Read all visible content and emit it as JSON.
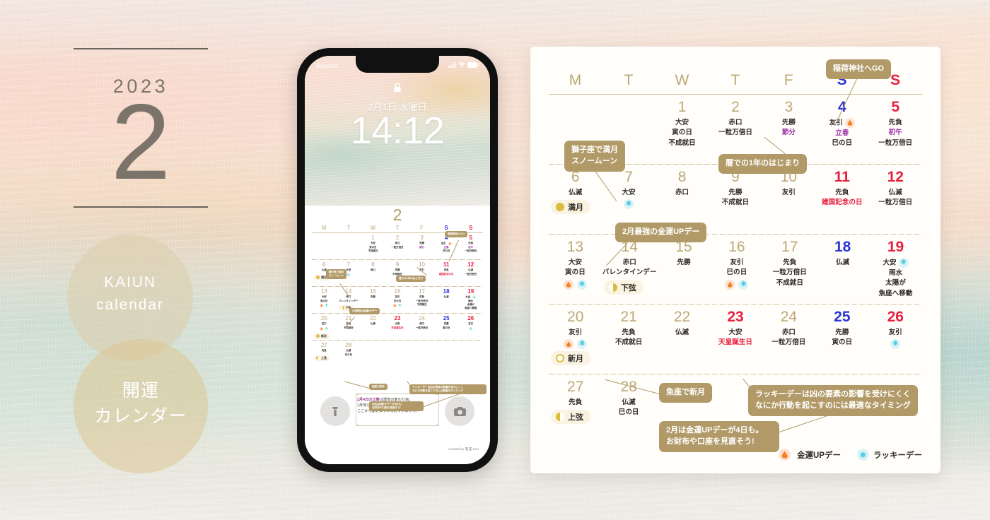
{
  "left": {
    "year": "2023",
    "month": "2",
    "circle_en": "KAIUN\ncalendar",
    "circle_ja": "開運\nカレンダー"
  },
  "phone": {
    "carrier": "docomo",
    "lock_icon": "lock-icon",
    "date": "2月1日 水曜日",
    "time": "14:12",
    "note_highlight": "2月4日の立春",
    "note_rest": "は運気の変わり目。",
    "note_line2": "1月何もできてなーいという人は",
    "note_line3": "ここから動き出すのもおすすめです。",
    "credit": "created by 開運 Sun",
    "left_button_icon": "flashlight-icon",
    "right_button_icon": "camera-icon"
  },
  "calendar": {
    "month_label": "2",
    "dow": [
      {
        "label": "M",
        "kind": "weekday"
      },
      {
        "label": "T",
        "kind": "weekday"
      },
      {
        "label": "W",
        "kind": "weekday"
      },
      {
        "label": "T",
        "kind": "weekday"
      },
      {
        "label": "F",
        "kind": "weekday"
      },
      {
        "label": "S",
        "kind": "sat"
      },
      {
        "label": "S",
        "kind": "sun"
      }
    ],
    "weeks": [
      [
        {
          "day": "",
          "kind": "",
          "notes": [],
          "icons": []
        },
        {
          "day": "",
          "kind": "",
          "notes": [],
          "icons": []
        },
        {
          "day": "1",
          "kind": "weekday",
          "notes": [
            {
              "t": "大安",
              "c": "black"
            },
            {
              "t": "寅の日",
              "c": "black"
            },
            {
              "t": "不成就日",
              "c": "black"
            }
          ],
          "icons": []
        },
        {
          "day": "2",
          "kind": "weekday",
          "notes": [
            {
              "t": "赤口",
              "c": "black"
            },
            {
              "t": "一粒万倍日",
              "c": "black"
            }
          ],
          "icons": []
        },
        {
          "day": "3",
          "kind": "weekday",
          "notes": [
            {
              "t": "先勝",
              "c": "black"
            },
            {
              "t": "節分",
              "c": "purple"
            }
          ],
          "icons": []
        },
        {
          "day": "4",
          "kind": "sat",
          "notes": [
            {
              "t": "友引",
              "c": "black",
              "icon": "money"
            },
            {
              "t": "立春",
              "c": "purple"
            },
            {
              "t": "巳の日",
              "c": "black"
            }
          ],
          "icons": []
        },
        {
          "day": "5",
          "kind": "sun",
          "notes": [
            {
              "t": "先負",
              "c": "black"
            },
            {
              "t": "初午",
              "c": "purple"
            },
            {
              "t": "一粒万倍日",
              "c": "black"
            }
          ],
          "icons": []
        }
      ],
      [
        {
          "day": "6",
          "kind": "weekday",
          "notes": [
            {
              "t": "仏滅",
              "c": "black"
            }
          ],
          "icons": [],
          "moon": {
            "type": "full",
            "label": "満月"
          }
        },
        {
          "day": "7",
          "kind": "weekday",
          "notes": [
            {
              "t": "大安",
              "c": "black"
            }
          ],
          "icons": [
            "lucky"
          ]
        },
        {
          "day": "8",
          "kind": "weekday",
          "notes": [
            {
              "t": "赤口",
              "c": "black"
            }
          ],
          "icons": []
        },
        {
          "day": "9",
          "kind": "weekday",
          "notes": [
            {
              "t": "先勝",
              "c": "black"
            },
            {
              "t": "不成就日",
              "c": "black"
            }
          ],
          "icons": []
        },
        {
          "day": "10",
          "kind": "weekday",
          "notes": [
            {
              "t": "友引",
              "c": "black"
            }
          ],
          "icons": []
        },
        {
          "day": "11",
          "kind": "sun",
          "notes": [
            {
              "t": "先負",
              "c": "black"
            },
            {
              "t": "建国記念の日",
              "c": "red"
            }
          ],
          "icons": []
        },
        {
          "day": "12",
          "kind": "sun",
          "notes": [
            {
              "t": "仏滅",
              "c": "black"
            },
            {
              "t": "一粒万倍日",
              "c": "black"
            }
          ],
          "icons": []
        }
      ],
      [
        {
          "day": "13",
          "kind": "weekday",
          "notes": [
            {
              "t": "大安",
              "c": "black"
            },
            {
              "t": "寅の日",
              "c": "black"
            }
          ],
          "icons": [
            "money",
            "lucky"
          ]
        },
        {
          "day": "14",
          "kind": "weekday",
          "notes": [
            {
              "t": "赤口",
              "c": "black"
            },
            {
              "t": "バレンタインデー",
              "c": "black",
              "wide": true
            }
          ],
          "icons": [],
          "moon": {
            "type": "last",
            "label": "下弦"
          }
        },
        {
          "day": "15",
          "kind": "weekday",
          "notes": [
            {
              "t": "先勝",
              "c": "black"
            }
          ],
          "icons": []
        },
        {
          "day": "16",
          "kind": "weekday",
          "notes": [
            {
              "t": "友引",
              "c": "black"
            },
            {
              "t": "巳の日",
              "c": "black"
            }
          ],
          "icons": [
            "money",
            "lucky"
          ]
        },
        {
          "day": "17",
          "kind": "weekday",
          "notes": [
            {
              "t": "先負",
              "c": "black"
            },
            {
              "t": "一粒万倍日",
              "c": "black"
            },
            {
              "t": "不成就日",
              "c": "black"
            }
          ],
          "icons": []
        },
        {
          "day": "18",
          "kind": "sat",
          "notes": [
            {
              "t": "仏滅",
              "c": "black"
            }
          ],
          "icons": []
        },
        {
          "day": "19",
          "kind": "sun",
          "notes": [
            {
              "t": "大安",
              "c": "black",
              "icon": "lucky"
            },
            {
              "t": "雨水",
              "c": "black"
            },
            {
              "t": "太陽が",
              "c": "black"
            },
            {
              "t": "魚座へ移動",
              "c": "black"
            }
          ],
          "icons": []
        }
      ],
      [
        {
          "day": "20",
          "kind": "weekday",
          "notes": [
            {
              "t": "友引",
              "c": "black"
            }
          ],
          "icons": [
            "money",
            "lucky"
          ],
          "moon": {
            "type": "new",
            "label": "新月"
          }
        },
        {
          "day": "21",
          "kind": "weekday",
          "notes": [
            {
              "t": "先負",
              "c": "black"
            },
            {
              "t": "不成就日",
              "c": "black"
            }
          ],
          "icons": []
        },
        {
          "day": "22",
          "kind": "weekday",
          "notes": [
            {
              "t": "仏滅",
              "c": "black"
            }
          ],
          "icons": []
        },
        {
          "day": "23",
          "kind": "sun",
          "notes": [
            {
              "t": "大安",
              "c": "black"
            },
            {
              "t": "天皇誕生日",
              "c": "red"
            }
          ],
          "icons": []
        },
        {
          "day": "24",
          "kind": "weekday",
          "notes": [
            {
              "t": "赤口",
              "c": "black"
            },
            {
              "t": "一粒万倍日",
              "c": "black"
            }
          ],
          "icons": []
        },
        {
          "day": "25",
          "kind": "sat",
          "notes": [
            {
              "t": "先勝",
              "c": "black"
            },
            {
              "t": "寅の日",
              "c": "black"
            }
          ],
          "icons": []
        },
        {
          "day": "26",
          "kind": "sun",
          "notes": [
            {
              "t": "友引",
              "c": "black"
            }
          ],
          "icons": [
            "lucky"
          ]
        }
      ],
      [
        {
          "day": "27",
          "kind": "weekday",
          "notes": [
            {
              "t": "先負",
              "c": "black"
            }
          ],
          "icons": [],
          "moon": {
            "type": "first",
            "label": "上弦"
          }
        },
        {
          "day": "28",
          "kind": "weekday",
          "notes": [
            {
              "t": "仏滅",
              "c": "black"
            },
            {
              "t": "巳の日",
              "c": "black"
            }
          ],
          "icons": []
        },
        {
          "day": "",
          "kind": "",
          "notes": [],
          "icons": []
        },
        {
          "day": "",
          "kind": "",
          "notes": [],
          "icons": []
        },
        {
          "day": "",
          "kind": "",
          "notes": [],
          "icons": []
        },
        {
          "day": "",
          "kind": "",
          "notes": [],
          "icons": []
        },
        {
          "day": "",
          "kind": "",
          "notes": [],
          "icons": []
        }
      ]
    ],
    "callouts": {
      "inari": "稲荷神社へGO",
      "shishi_l1": "獅子座で満月",
      "shishi_l2": "スノームーン",
      "koyomi": "暦での1年のはじまり",
      "kinun": "2月最強の金運UPデー",
      "uoza": "魚座で新月",
      "lucky_l1": "ラッキーデーは凶の要素の影響を受けにくく",
      "lucky_l2": "なにか行動を起こすのには最適なタイミング",
      "kane_l1": "2月は金運UPデーが4日も。",
      "kane_l2": "お財布や口座を見直そう!"
    },
    "legend": {
      "money": "金運UPデー",
      "lucky": "ラッキーデー"
    }
  },
  "colors": {
    "gold": "#bda876",
    "callout_tan": "#b29a68",
    "saturday_blue": "#2b35d8",
    "sunday_red": "#e8203f",
    "purple": "#9b2fa3",
    "money_orange": "#f58120",
    "lucky_cyan": "#54cfe2",
    "moon_yellow": "#dcbb3f",
    "card_bg": "#fffefb"
  }
}
